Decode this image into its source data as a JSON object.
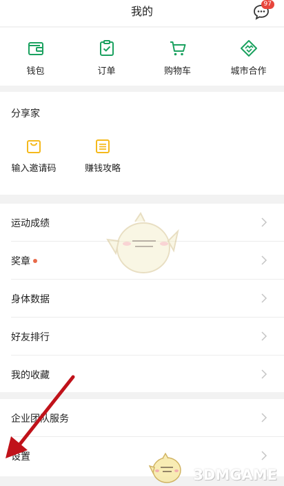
{
  "header": {
    "title": "我的",
    "message_badge": "97",
    "message_icon": "chat-bubble-icon"
  },
  "quick": [
    {
      "label": "钱包",
      "icon": "wallet-icon"
    },
    {
      "label": "订单",
      "icon": "order-clipboard-icon"
    },
    {
      "label": "购物车",
      "icon": "shopping-cart-icon"
    },
    {
      "label": "城市合作",
      "icon": "handshake-icon"
    }
  ],
  "share": {
    "title": "分享家",
    "items": [
      {
        "label": "输入邀请码",
        "icon": "invite-bag-icon"
      },
      {
        "label": "赚钱攻略",
        "icon": "guide-list-icon"
      }
    ]
  },
  "list1": [
    "运动成绩",
    "奖章",
    "身体数据",
    "好友排行",
    "我的收藏"
  ],
  "list2": [
    "企业团队服务",
    "设置"
  ],
  "watermark": "3DMGAME",
  "colors": {
    "accent_green": "#1aa15f",
    "accent_yellow": "#f5b91c",
    "badge_red": "#e8453c",
    "arrow_red": "#c0121a"
  }
}
